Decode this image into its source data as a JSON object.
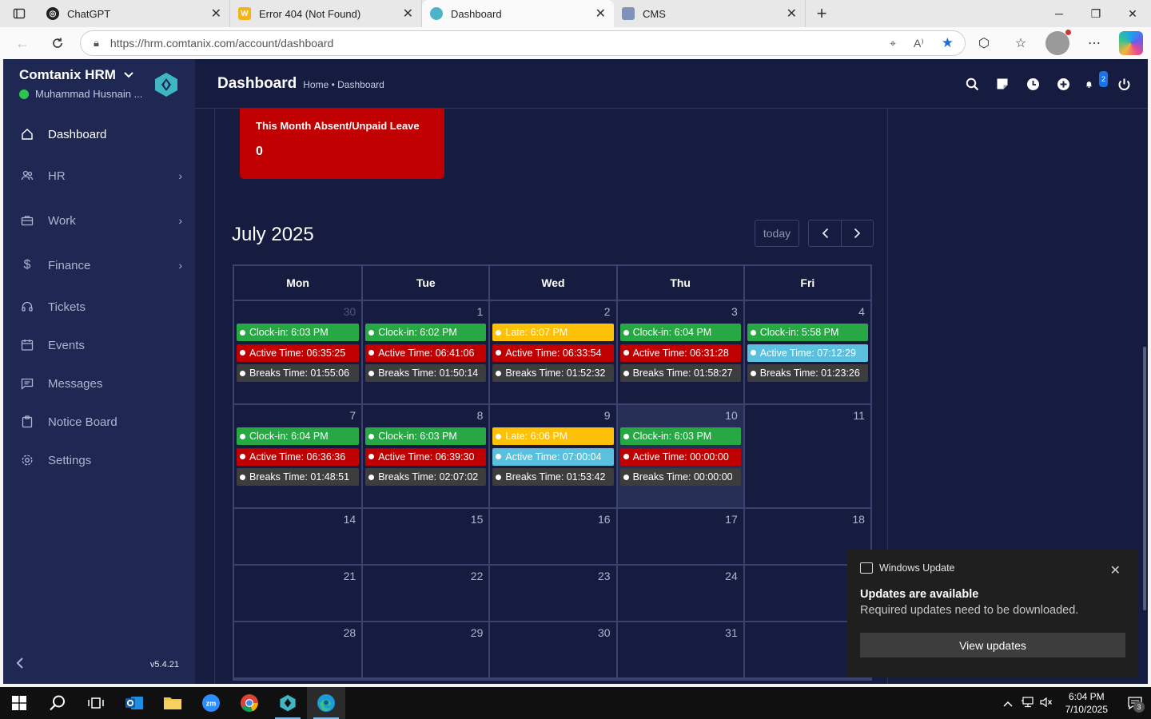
{
  "browser": {
    "tabs": [
      {
        "title": "ChatGPT",
        "favicon": "chatgpt-icon",
        "active": false
      },
      {
        "title": "Error 404 (Not Found)",
        "favicon": "w-icon",
        "active": false
      },
      {
        "title": "Dashboard",
        "favicon": "hrm-icon",
        "active": true
      },
      {
        "title": "CMS",
        "favicon": "cms-icon",
        "active": false
      }
    ],
    "url": "https://hrm.comtanix.com/account/dashboard"
  },
  "sidebar": {
    "brand": "Comtanix HRM",
    "user": "Muhammad Husnain ...",
    "items": [
      {
        "label": "Dashboard",
        "icon": "home-icon",
        "active": true,
        "has_children": false
      },
      {
        "label": "HR",
        "icon": "users-icon",
        "active": false,
        "has_children": true
      },
      {
        "label": "Work",
        "icon": "briefcase-icon",
        "active": false,
        "has_children": true
      },
      {
        "label": "Finance",
        "icon": "dollar-icon",
        "active": false,
        "has_children": true
      },
      {
        "label": "Tickets",
        "icon": "headset-icon",
        "active": false,
        "has_children": false
      },
      {
        "label": "Events",
        "icon": "calendar-icon",
        "active": false,
        "has_children": false
      },
      {
        "label": "Messages",
        "icon": "message-icon",
        "active": false,
        "has_children": false
      },
      {
        "label": "Notice Board",
        "icon": "clipboard-icon",
        "active": false,
        "has_children": false
      },
      {
        "label": "Settings",
        "icon": "gear-icon",
        "active": false,
        "has_children": false
      }
    ],
    "version": "v5.4.21"
  },
  "header": {
    "title": "Dashboard",
    "breadcrumb": "Home • Dashboard",
    "notification_count": "2"
  },
  "leave_card": {
    "title": "This Month Absent/Unpaid Leave",
    "value": "0"
  },
  "calendar": {
    "title": "July 2025",
    "today_label": "today",
    "weekdays": [
      "Mon",
      "Tue",
      "Wed",
      "Thu",
      "Fri"
    ],
    "weeks": [
      {
        "size": "big",
        "days": [
          {
            "num": "30",
            "muted": true,
            "events": [
              {
                "text": "Clock-in: 6:03 PM",
                "kind": "clock"
              },
              {
                "text": "Active Time: 06:35:25",
                "kind": "active-red"
              },
              {
                "text": "Breaks Time: 01:55:06",
                "kind": "break"
              }
            ]
          },
          {
            "num": "1",
            "events": [
              {
                "text": "Clock-in: 6:02 PM",
                "kind": "clock"
              },
              {
                "text": "Active Time: 06:41:06",
                "kind": "active-red"
              },
              {
                "text": "Breaks Time: 01:50:14",
                "kind": "break"
              }
            ]
          },
          {
            "num": "2",
            "events": [
              {
                "text": "Late: 6:07 PM",
                "kind": "late"
              },
              {
                "text": "Active Time: 06:33:54",
                "kind": "active-red"
              },
              {
                "text": "Breaks Time: 01:52:32",
                "kind": "break"
              }
            ]
          },
          {
            "num": "3",
            "events": [
              {
                "text": "Clock-in: 6:04 PM",
                "kind": "clock"
              },
              {
                "text": "Active Time: 06:31:28",
                "kind": "active-red"
              },
              {
                "text": "Breaks Time: 01:58:27",
                "kind": "break"
              }
            ]
          },
          {
            "num": "4",
            "events": [
              {
                "text": "Clock-in: 5:58 PM",
                "kind": "clock"
              },
              {
                "text": "Active Time: 07:12:29",
                "kind": "active-blue"
              },
              {
                "text": "Breaks Time: 01:23:26",
                "kind": "break"
              }
            ]
          }
        ]
      },
      {
        "size": "big",
        "days": [
          {
            "num": "7",
            "events": [
              {
                "text": "Clock-in: 6:04 PM",
                "kind": "clock"
              },
              {
                "text": "Active Time: 06:36:36",
                "kind": "active-red"
              },
              {
                "text": "Breaks Time: 01:48:51",
                "kind": "break"
              }
            ]
          },
          {
            "num": "8",
            "events": [
              {
                "text": "Clock-in: 6:03 PM",
                "kind": "clock"
              },
              {
                "text": "Active Time: 06:39:30",
                "kind": "active-red"
              },
              {
                "text": "Breaks Time: 02:07:02",
                "kind": "break"
              }
            ]
          },
          {
            "num": "9",
            "events": [
              {
                "text": "Late: 6:06 PM",
                "kind": "late"
              },
              {
                "text": "Active Time: 07:00:04",
                "kind": "active-blue"
              },
              {
                "text": "Breaks Time: 01:53:42",
                "kind": "break"
              }
            ]
          },
          {
            "num": "10",
            "today": true,
            "events": [
              {
                "text": "Clock-in: 6:03 PM",
                "kind": "clock"
              },
              {
                "text": "Active Time: 00:00:00",
                "kind": "active-red"
              },
              {
                "text": "Breaks Time: 00:00:00",
                "kind": "break"
              }
            ]
          },
          {
            "num": "11",
            "events": []
          }
        ]
      },
      {
        "size": "small",
        "days": [
          {
            "num": "14",
            "events": []
          },
          {
            "num": "15",
            "events": []
          },
          {
            "num": "16",
            "events": []
          },
          {
            "num": "17",
            "events": []
          },
          {
            "num": "18",
            "events": []
          }
        ]
      },
      {
        "size": "small",
        "days": [
          {
            "num": "21",
            "events": []
          },
          {
            "num": "22",
            "events": []
          },
          {
            "num": "23",
            "events": []
          },
          {
            "num": "24",
            "events": []
          },
          {
            "num": "",
            "events": []
          }
        ]
      },
      {
        "size": "small",
        "days": [
          {
            "num": "28",
            "events": []
          },
          {
            "num": "29",
            "events": []
          },
          {
            "num": "30",
            "events": []
          },
          {
            "num": "31",
            "events": []
          },
          {
            "num": "",
            "events": []
          }
        ]
      }
    ],
    "event_colors": {
      "clock": "#28a745",
      "active-red": "#c00000",
      "active-blue": "#5bc0de",
      "late": "#ffc107",
      "break": "#3d3d3d"
    }
  },
  "toast": {
    "app": "Windows Update",
    "title": "Updates are available",
    "message": "Required updates need to be downloaded.",
    "button": "View updates"
  },
  "taskbar": {
    "time": "6:04 PM",
    "date": "7/10/2025",
    "notification_count": "3"
  }
}
